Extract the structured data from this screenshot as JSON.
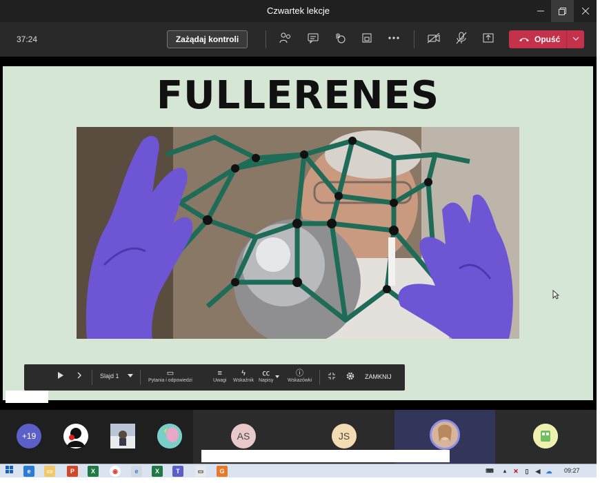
{
  "window": {
    "title": "Czwartek lekcje"
  },
  "toolbar": {
    "timer": "37:24",
    "request_control_label": "Zażądaj kontroli",
    "leave_label": "Opuść"
  },
  "slide": {
    "title": "FULLERENES"
  },
  "presenter_bar": {
    "slide_label": "Slajd 1",
    "qa_label": "Pytania i odpowiedzi",
    "notes_label": "Uwagi",
    "laser_label": "Wskaźnik",
    "captions_label": "Napisy",
    "tips_label": "Wskazówki",
    "close_label": "ZAMKNIJ"
  },
  "participants": {
    "overflow_count": "+19",
    "tiles": [
      {
        "initials": "AS"
      },
      {
        "initials": "JS"
      }
    ]
  },
  "taskbar": {
    "time": "09:27"
  },
  "colors": {
    "leave": "#c4314b",
    "slide_bg": "#d6e6d4",
    "overflow_avatar": "#5b5fc7"
  }
}
